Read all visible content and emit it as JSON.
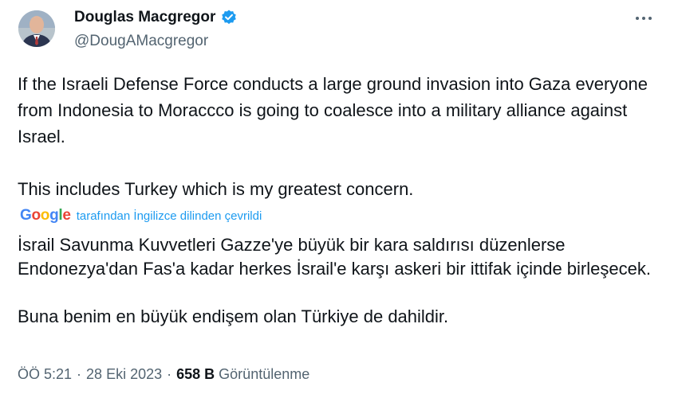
{
  "author": {
    "display_name": "Douglas Macgregor",
    "handle": "@DougAMacgregor",
    "verified": true
  },
  "tweet": {
    "paragraphs": [
      "If the Israeli Defense Force conducts a large ground invasion into Gaza everyone from Indonesia to Moraccco is going to coalesce into a military alliance against Israel.",
      "This includes Turkey which is my greatest concern."
    ]
  },
  "translation": {
    "provider": "Google",
    "label": "tarafından İngilizce dilinden çevrildi",
    "paragraphs": [
      "İsrail Savunma Kuvvetleri Gazze'ye büyük bir kara saldırısı düzenlerse Endonezya'dan Fas'a kadar herkes İsrail'e karşı askeri bir ittifak içinde birleşecek.",
      "Buna benim en büyük endişem olan Türkiye de dahildir."
    ]
  },
  "meta": {
    "time": "ÖÖ 5:21",
    "separator": "·",
    "date": "28 Eki 2023",
    "views_count": "658 B",
    "views_label": "Görüntülenme"
  },
  "colors": {
    "accent": "#1d9bf0",
    "text_primary": "#0f1419",
    "text_secondary": "#536471"
  },
  "icons": {
    "verified": "verified-badge-icon",
    "more": "more-dots-icon"
  }
}
